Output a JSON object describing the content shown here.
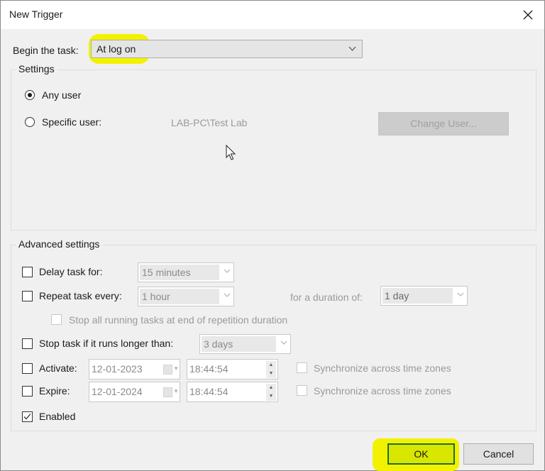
{
  "window": {
    "title": "New Trigger",
    "close_icon": "close-icon"
  },
  "begin": {
    "label": "Begin the task:",
    "value": "At log on"
  },
  "settings": {
    "group_title": "Settings",
    "any_user_label": "Any user",
    "any_user_selected": true,
    "specific_user_label": "Specific user:",
    "specific_user_selected": false,
    "user_value": "LAB-PC\\Test Lab",
    "change_user_button": "Change User..."
  },
  "advanced": {
    "group_title": "Advanced settings",
    "delay": {
      "label": "Delay task for:",
      "checked": false,
      "value": "15 minutes"
    },
    "repeat": {
      "label": "Repeat task every:",
      "checked": false,
      "value": "1 hour",
      "duration_label": "for a duration of:",
      "duration_value": "1 day"
    },
    "stop_all": {
      "label": "Stop all running tasks at end of repetition duration",
      "checked": false
    },
    "stop_longer": {
      "label": "Stop task if it runs longer than:",
      "checked": false,
      "value": "3 days"
    },
    "activate": {
      "label": "Activate:",
      "checked": false,
      "date": "12-01-2023",
      "time": "18:44:54",
      "sync_label": "Synchronize across time zones",
      "sync_checked": false
    },
    "expire": {
      "label": "Expire:",
      "checked": false,
      "date": "12-01-2024",
      "time": "18:44:54",
      "sync_label": "Synchronize across time zones",
      "sync_checked": false
    },
    "enabled": {
      "label": "Enabled",
      "checked": true
    }
  },
  "buttons": {
    "ok": "OK",
    "cancel": "Cancel"
  },
  "colors": {
    "highlight": "#f2f200",
    "ok_border": "#1e6e1e"
  }
}
